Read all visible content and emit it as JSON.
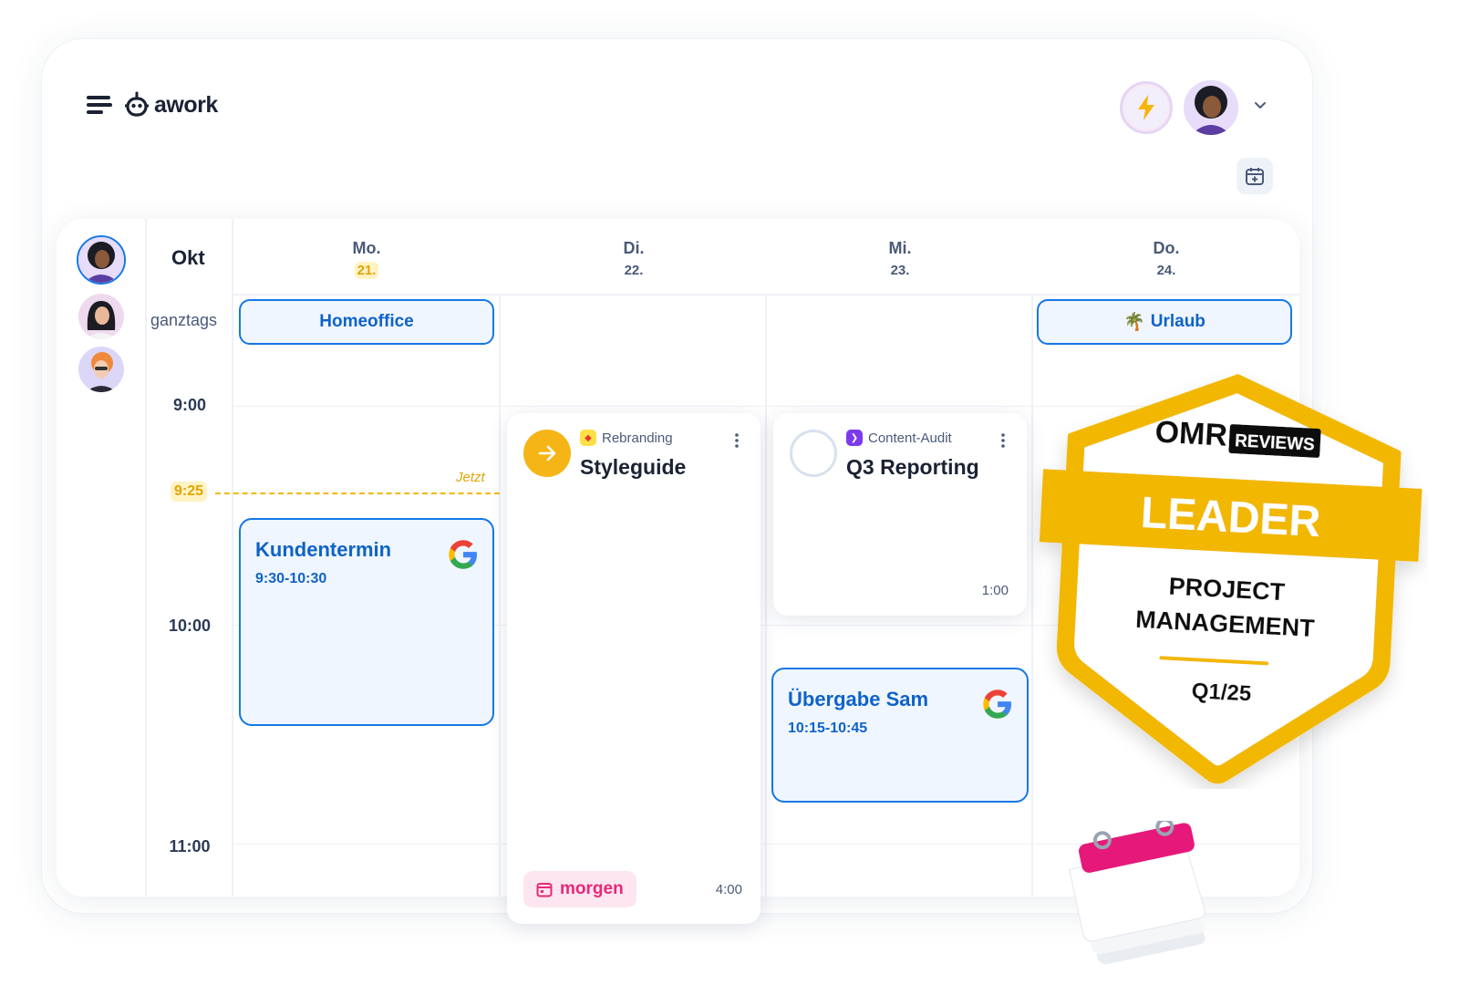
{
  "app": {
    "name": "awork"
  },
  "header": {
    "bolt_icon": "lightning-bolt-icon"
  },
  "calendar": {
    "month": "Okt",
    "allday_label": "ganztags",
    "days": [
      {
        "name": "Mo.",
        "num": "21.",
        "today": true
      },
      {
        "name": "Di.",
        "num": "22.",
        "today": false
      },
      {
        "name": "Mi.",
        "num": "23.",
        "today": false
      },
      {
        "name": "Do.",
        "num": "24.",
        "today": false
      }
    ],
    "times": [
      "9:00",
      "10:00",
      "11:00"
    ],
    "now": {
      "time": "9:25",
      "label": "Jetzt"
    },
    "allday_events": [
      {
        "title": "Homeoffice",
        "icon": ""
      },
      {
        "title": "Urlaub",
        "icon": "🌴"
      }
    ],
    "events": [
      {
        "title": "Kundentermin",
        "time": "9:30-10:30"
      },
      {
        "title": "Übergabe Sam",
        "time": "10:15-10:45"
      }
    ],
    "tasks": [
      {
        "project": "Rebranding",
        "title": "Styleguide",
        "due": "morgen",
        "duration": "4:00"
      },
      {
        "project": "Content-Audit",
        "title": "Q3 Reporting",
        "duration": "1:00"
      }
    ]
  },
  "badge": {
    "brand": "OMR",
    "brand_tag": "REVIEWS",
    "ribbon": "LEADER",
    "line1": "PROJECT",
    "line2": "MANAGEMENT",
    "period": "Q1/25"
  },
  "colors": {
    "accent_blue": "#1478e6",
    "now_yellow": "#f0b800",
    "badge_yellow": "#f2b705",
    "due_pink": "#e8287a"
  }
}
